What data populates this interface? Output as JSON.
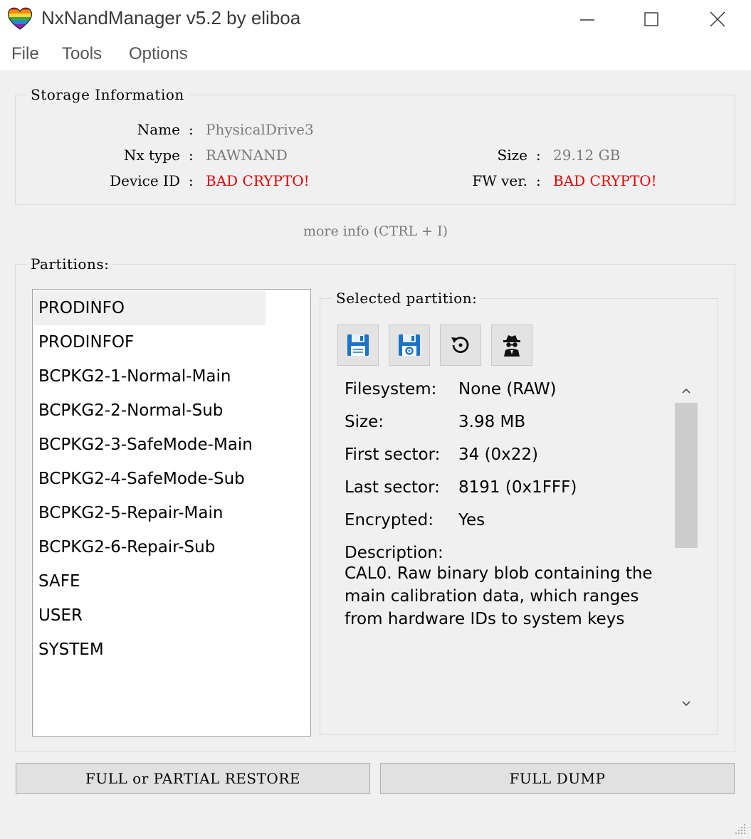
{
  "window": {
    "title": "NxNandManager v5.2 by eliboa",
    "icon": "heart-icon",
    "controls": [
      "minimize-icon",
      "maximize-icon",
      "close-icon"
    ]
  },
  "menu": [
    "File",
    "Tools",
    "Options"
  ],
  "storage": {
    "title": "Storage Information",
    "name_label": "Name",
    "name_value": "PhysicalDrive3",
    "nxtype_label": "Nx type",
    "nxtype_value": "RAWNAND",
    "size_label": "Size",
    "size_value": "29.12 GB",
    "deviceid_label": "Device ID",
    "deviceid_value": "BAD CRYPTO!",
    "fwver_label": "FW ver.",
    "fwver_value": "BAD CRYPTO!",
    "separator": ":"
  },
  "more_info": "more info (CTRL + I)",
  "partitions": {
    "title": "Partitions:",
    "items": [
      "PRODINFO",
      "PRODINFOF",
      "BCPKG2-1-Normal-Main",
      "BCPKG2-2-Normal-Sub",
      "BCPKG2-3-SafeMode-Main",
      "BCPKG2-4-SafeMode-Sub",
      "BCPKG2-5-Repair-Main",
      "BCPKG2-6-Repair-Sub",
      "SAFE",
      "USER",
      "SYSTEM"
    ],
    "selected": "PRODINFO"
  },
  "selected_partition": {
    "title": "Selected partition:",
    "tools": [
      "save-icon",
      "save-settings-icon",
      "restore-icon",
      "spy-icon"
    ],
    "filesystem_label": "Filesystem:",
    "filesystem_value": "None (RAW)",
    "size_label": "Size:",
    "size_value": "3.98 MB",
    "first_sector_label": "First sector:",
    "first_sector_value": "34 (0x22)",
    "last_sector_label": "Last sector:",
    "last_sector_value": "8191 (0x1FFF)",
    "encrypted_label": "Encrypted:",
    "encrypted_value": "Yes",
    "description_label": "Description:",
    "description_value": "CAL0. Raw binary blob containing the main calibration data, which ranges from hardware IDs to system keys"
  },
  "buttons": {
    "restore": "FULL or PARTIAL RESTORE",
    "dump": "FULL DUMP"
  },
  "colors": {
    "error": "#e00000",
    "muted": "#7a7a7a",
    "floppy_blue": "#1a73c8"
  }
}
